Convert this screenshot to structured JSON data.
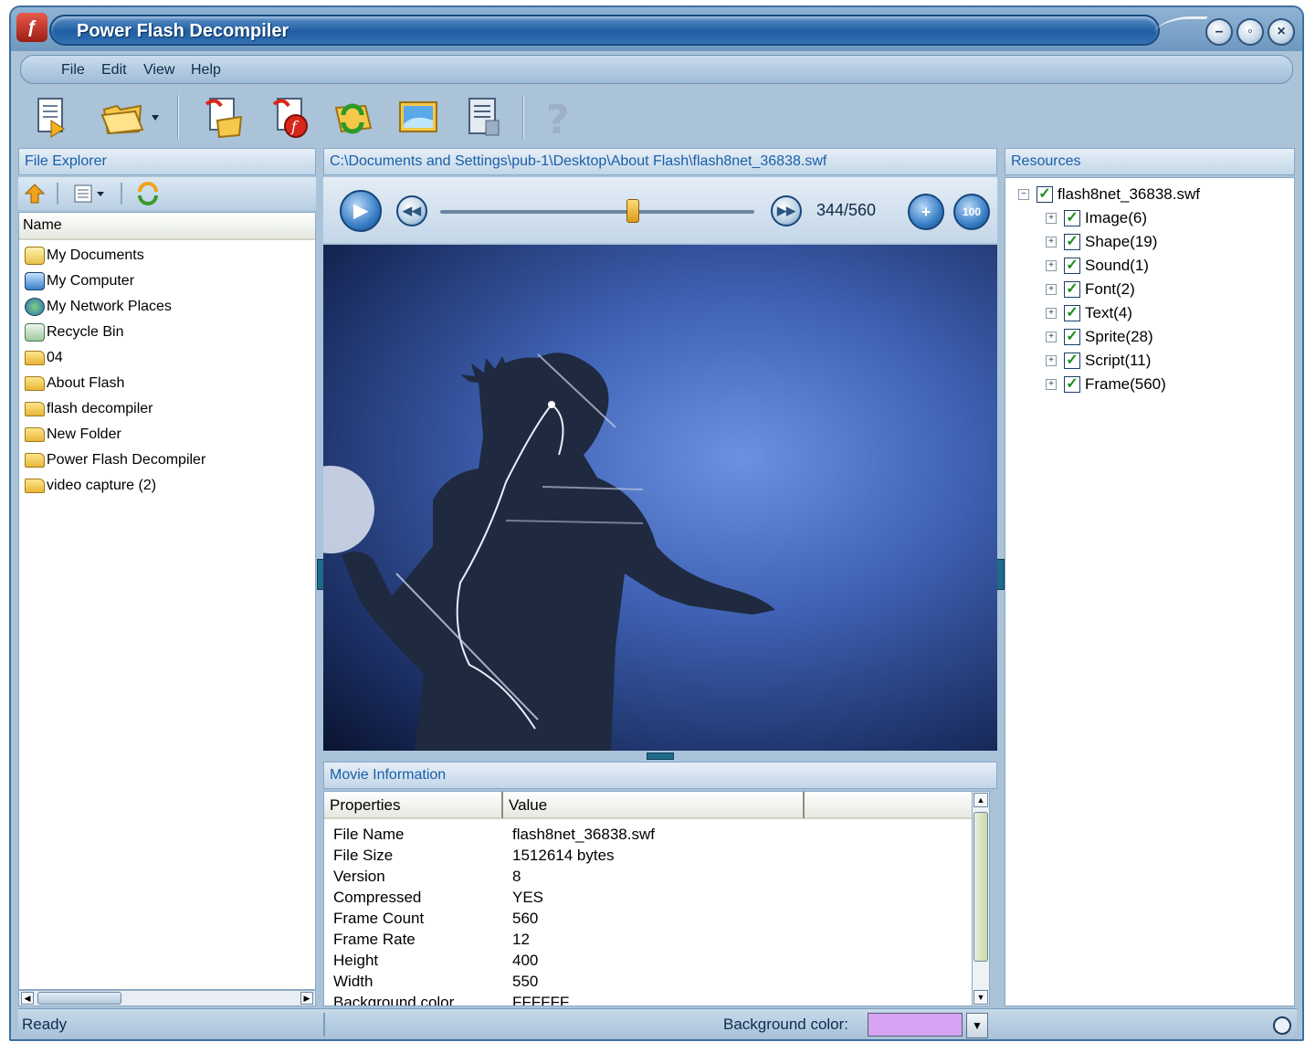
{
  "window": {
    "title": "Power Flash Decompiler",
    "controls": [
      "minimize",
      "restore",
      "close"
    ]
  },
  "menu": {
    "items": [
      "File",
      "Edit",
      "View",
      "Help"
    ]
  },
  "toolbar": {
    "icons": [
      "export-selected-icon",
      "open-folder-icon",
      "dropdown-arrow-icon",
      "extract-icon",
      "convert-to-flash-icon",
      "refresh-resources-icon",
      "preview-image-icon",
      "properties-icon",
      "help-icon"
    ]
  },
  "file_explorer": {
    "title": "File Explorer",
    "column_header": "Name",
    "items": [
      {
        "label": "My Documents",
        "icon": "my-documents-icon"
      },
      {
        "label": "My Computer",
        "icon": "my-computer-icon"
      },
      {
        "label": "My Network Places",
        "icon": "network-places-icon"
      },
      {
        "label": "Recycle Bin",
        "icon": "recycle-bin-icon"
      },
      {
        "label": "04",
        "icon": "folder-icon"
      },
      {
        "label": "About Flash",
        "icon": "folder-icon"
      },
      {
        "label": "flash decompiler",
        "icon": "folder-icon"
      },
      {
        "label": "New Folder",
        "icon": "folder-icon"
      },
      {
        "label": "Power Flash Decompiler",
        "icon": "folder-icon"
      },
      {
        "label": "video capture (2)",
        "icon": "folder-icon"
      }
    ]
  },
  "viewer": {
    "path": "C:\\Documents and Settings\\pub-1\\Desktop\\About Flash\\flash8net_36838.swf",
    "frame_display": "344/560",
    "current_frame": 344,
    "total_frames": 560
  },
  "movie_info": {
    "title": "Movie Information",
    "columns": [
      "Properties",
      "Value",
      ""
    ],
    "rows": [
      {
        "property": "File Name",
        "value": "flash8net_36838.swf"
      },
      {
        "property": "File Size",
        "value": "1512614 bytes"
      },
      {
        "property": "Version",
        "value": "8"
      },
      {
        "property": "Compressed",
        "value": "YES"
      },
      {
        "property": "Frame Count",
        "value": "560"
      },
      {
        "property": "Frame Rate",
        "value": "12"
      },
      {
        "property": "Height",
        "value": "400"
      },
      {
        "property": "Width",
        "value": "550"
      },
      {
        "property": "Background color",
        "value": "FFFFFF"
      }
    ]
  },
  "resources": {
    "title": "Resources",
    "root": "flash8net_36838.swf",
    "children": [
      "Image(6)",
      "Shape(19)",
      "Sound(1)",
      "Font(2)",
      "Text(4)",
      "Sprite(28)",
      "Script(11)",
      "Frame(560)"
    ]
  },
  "status": {
    "text": "Ready",
    "bg_label": "Background color:",
    "bg_color": "#d6a4f2"
  },
  "colors": {
    "title_blue": "#1f5ea3",
    "panel_header_text": "#1a5ea8",
    "stage_glow": "#6a92e0"
  }
}
